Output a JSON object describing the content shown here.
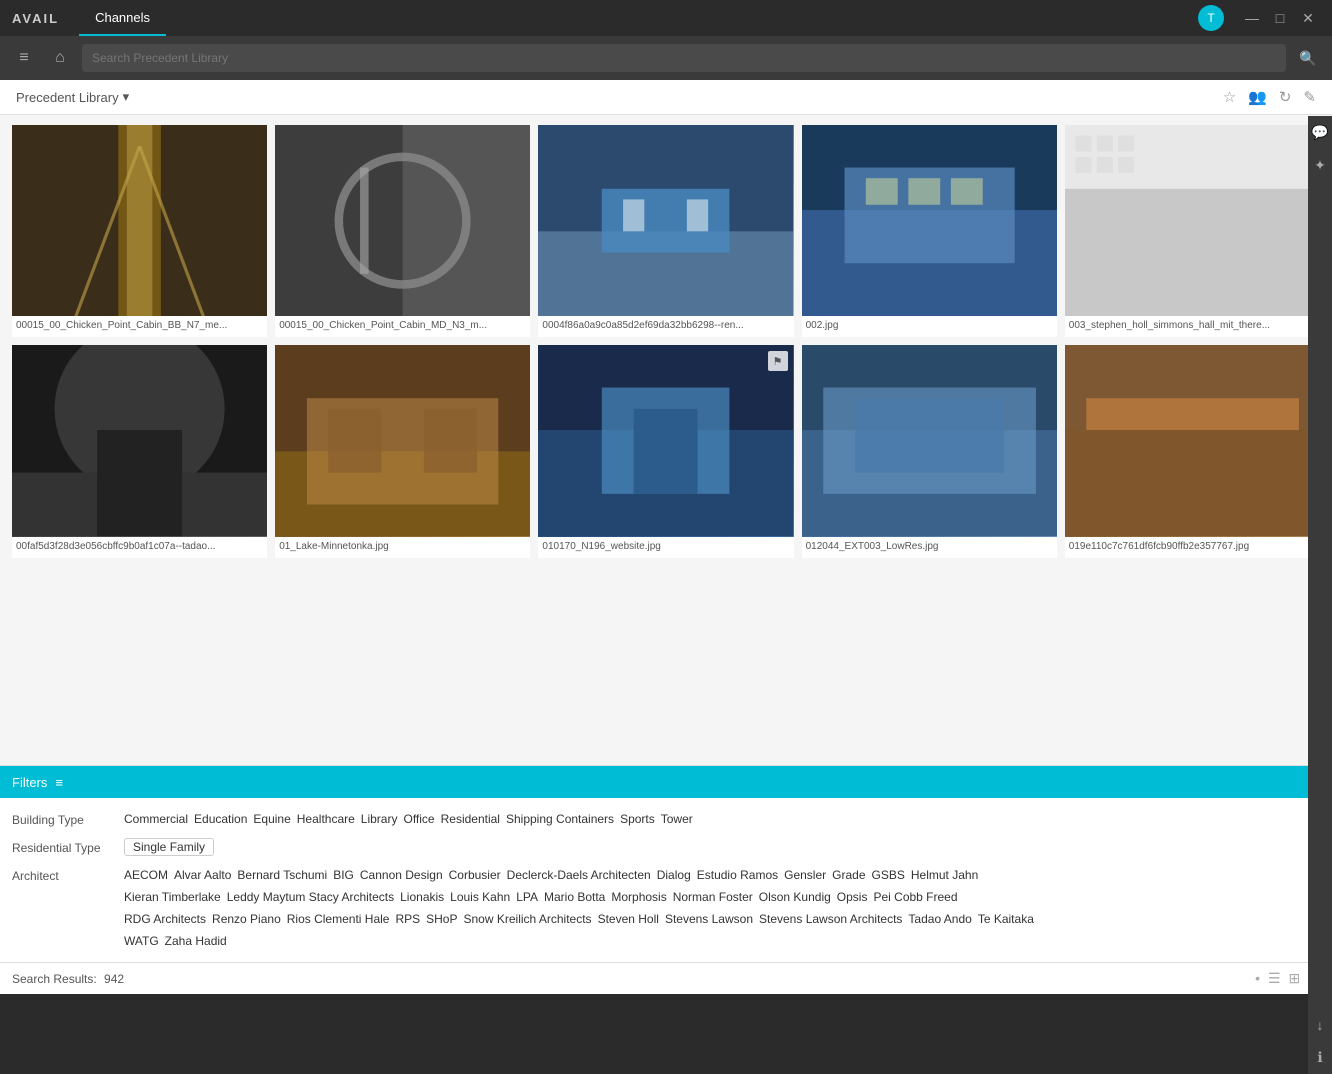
{
  "app": {
    "logo": "AVAIL",
    "tab_label": "Channels"
  },
  "titlebar": {
    "avatar_initial": "T",
    "minimize": "—",
    "maximize": "□",
    "close": "✕"
  },
  "toolbar": {
    "search_placeholder": "Search Precedent Library",
    "home_icon": "⌂",
    "menu_icon": "≡"
  },
  "content": {
    "title": "Precedent Library",
    "dropdown_icon": "▾"
  },
  "images": [
    {
      "id": 1,
      "filename": "00015_00_Chicken_Point_Cabin_BB_N7_me...",
      "css_class": "img-1"
    },
    {
      "id": 2,
      "filename": "00015_00_Chicken_Point_Cabin_MD_N3_m...",
      "css_class": "img-2"
    },
    {
      "id": 3,
      "filename": "0004f86a0a9c0a85d2ef69da32bb6298--ren...",
      "css_class": "img-3"
    },
    {
      "id": 4,
      "filename": "002.jpg",
      "css_class": "img-4"
    },
    {
      "id": 5,
      "filename": "003_stephen_holl_simmons_hall_mit_there...",
      "css_class": "img-5"
    },
    {
      "id": 6,
      "filename": "00faf5d3f28d3e056cbffc9b0af1c07a--tadao...",
      "css_class": "img-6"
    },
    {
      "id": 7,
      "filename": "01_Lake-Minnetonka.jpg",
      "css_class": "img-7"
    },
    {
      "id": 8,
      "filename": "010170_N196_website.jpg",
      "css_class": "img-8"
    },
    {
      "id": 9,
      "filename": "012044_EXT003_LowRes.jpg",
      "css_class": "img-9"
    },
    {
      "id": 10,
      "filename": "019e110c7c761df6fcb90ffb2e357767.jpg",
      "css_class": "img-10"
    }
  ],
  "filters": {
    "header_label": "Filters",
    "building_type_label": "Building Type",
    "building_type_tags": [
      "Commercial",
      "Education",
      "Equine",
      "Healthcare",
      "Library",
      "Office",
      "Residential",
      "Shipping Containers",
      "Sports",
      "Tower"
    ],
    "residential_type_label": "Residential Type",
    "residential_type_tags": [
      "Single Family"
    ],
    "architect_label": "Architect",
    "architect_row1": [
      "AECOM",
      "Alvar Aalto",
      "Bernard Tschumi",
      "BIG",
      "Cannon Design",
      "Corbusier",
      "Declerck-Daels Architecten",
      "Dialog",
      "Estudio Ramos",
      "Gensler",
      "Grade",
      "GSBS",
      "Helmut Jahn"
    ],
    "architect_row2": [
      "Kieran Timberlake",
      "Leddy Maytum Stacy Architects",
      "Lionakis",
      "Louis Kahn",
      "LPA",
      "Mario Botta",
      "Morphosis",
      "Norman Foster",
      "Olson Kundig",
      "Opsis",
      "Pei Cobb Freed"
    ],
    "architect_row3": [
      "RDG Architects",
      "Renzo Piano",
      "Rios Clementi Hale",
      "RPS",
      "SHoP",
      "Snow Kreilich Architects",
      "Steven Holl",
      "Stevens Lawson",
      "Stevens Lawson Architects",
      "Tadao Ando",
      "Te Kaitaka"
    ],
    "architect_row4": [
      "WATG",
      "Zaha Hadid"
    ]
  },
  "statusbar": {
    "search_results_label": "Search Results:",
    "result_count": "942"
  },
  "icons": {
    "menu": "≡",
    "home": "⌂",
    "search": "🔍",
    "star": "☆",
    "people": "👥",
    "refresh": "↻",
    "edit": "✎",
    "chat": "💬",
    "magic": "✦",
    "download": "↓",
    "info": "ℹ",
    "filter_lines": "≡",
    "flag": "⚑",
    "list_view": "☰",
    "grid_view": "⊞",
    "detail_view": "⊟",
    "dot": "•"
  }
}
